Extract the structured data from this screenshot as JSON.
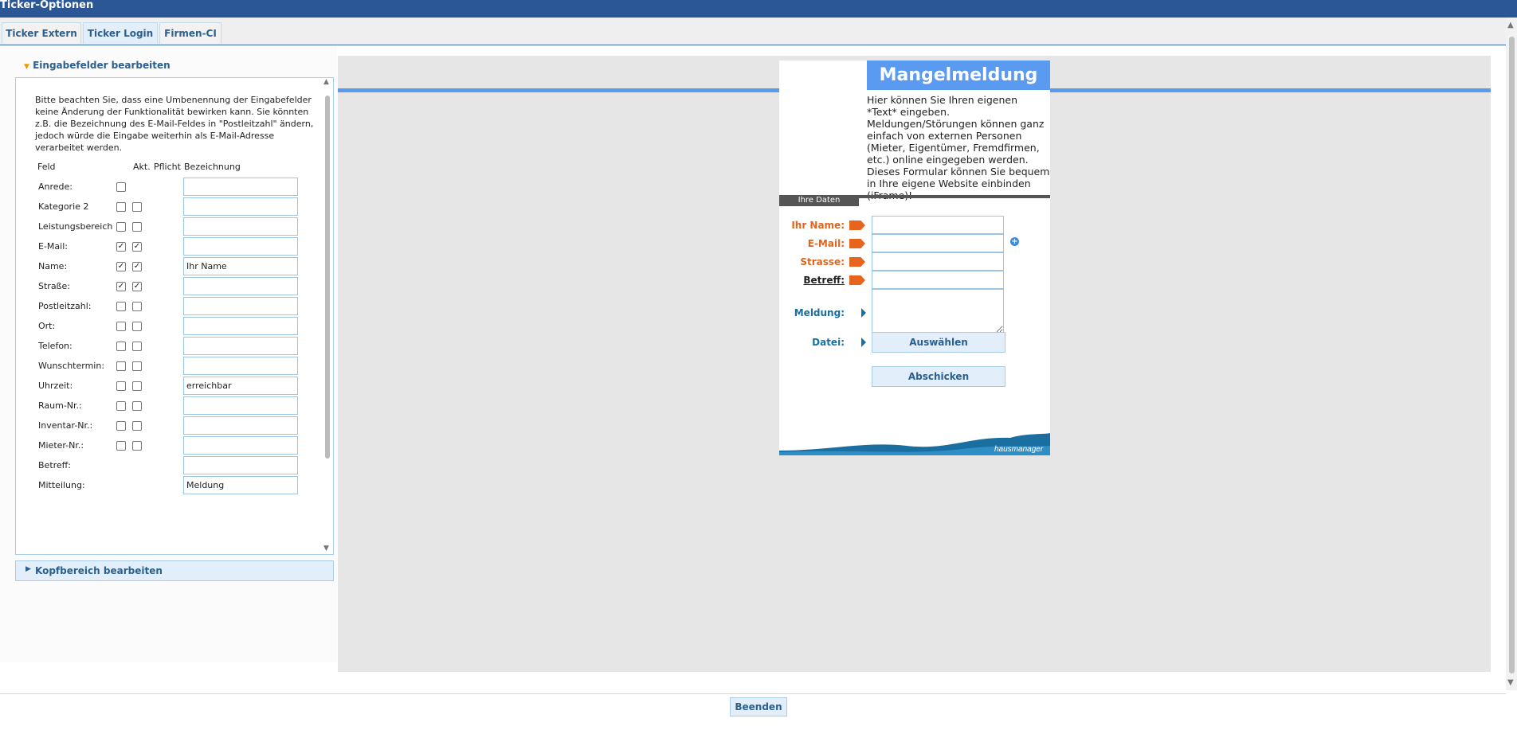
{
  "window": {
    "title": "Ticker-Optionen"
  },
  "tabs": [
    {
      "label": "Ticker Extern"
    },
    {
      "label": "Ticker Login"
    },
    {
      "label": "Firmen-CI"
    }
  ],
  "left": {
    "section1": {
      "title": "Eingabefelder bearbeiten",
      "info": "Bitte beachten Sie, dass eine Umbenennung der Eingabefelder keine Änderung der Funktionalität bewirken kann. Sie könnten z.B. die Bezeichnung des E-Mail-Feldes in \"Postleitzahl\" ändern, jedoch würde die Eingabe weiterhin als E-Mail-Adresse verarbeitet werden.",
      "col_field": "Feld",
      "col_active": "Akt.",
      "col_required": "Pflicht",
      "col_label": "Bezeichnung",
      "rows": [
        {
          "field": "Anrede:",
          "active": false,
          "required": null,
          "value": ""
        },
        {
          "field": "Kategorie 2",
          "active": false,
          "required": false,
          "value": ""
        },
        {
          "field": "Leistungsbereich",
          "active": false,
          "required": false,
          "value": ""
        },
        {
          "field": "E-Mail:",
          "active": true,
          "required": true,
          "value": ""
        },
        {
          "field": "Name:",
          "active": true,
          "required": true,
          "value": "Ihr Name"
        },
        {
          "field": "Straße:",
          "active": true,
          "required": true,
          "value": ""
        },
        {
          "field": "Postleitzahl:",
          "active": false,
          "required": false,
          "value": ""
        },
        {
          "field": "Ort:",
          "active": false,
          "required": false,
          "value": ""
        },
        {
          "field": "Telefon:",
          "active": false,
          "required": false,
          "value": ""
        },
        {
          "field": "Wunschtermin:",
          "active": false,
          "required": false,
          "value": ""
        },
        {
          "field": "Uhrzeit:",
          "active": false,
          "required": false,
          "value": "erreichbar"
        },
        {
          "field": "Raum-Nr.:",
          "active": false,
          "required": false,
          "value": ""
        },
        {
          "field": "Inventar-Nr.:",
          "active": false,
          "required": false,
          "value": ""
        },
        {
          "field": "Mieter-Nr.:",
          "active": false,
          "required": false,
          "value": ""
        },
        {
          "field": "Betreff:",
          "active": null,
          "required": null,
          "value": ""
        },
        {
          "field": "Mitteilung:",
          "active": null,
          "required": null,
          "value": "Meldung"
        }
      ]
    },
    "section2": {
      "title": "Kopfbereich bearbeiten"
    }
  },
  "preview": {
    "title": "Mangelmeldung",
    "text": "Hier können Sie Ihren eigenen *Text* eingeben. Meldungen/Störungen können ganz einfach von externen Personen (Mieter, Eigentümer, Fremdfirmen, etc.) online eingegeben werden. Dieses Formular können Sie bequem in Ihre eigene Website einbinden (iFrame)!",
    "section_label": "Ihre Daten",
    "fields": {
      "name": "Ihr Name:",
      "email": "E-Mail:",
      "strasse": "Strasse:",
      "betreff": "Betreff:",
      "meldung": "Meldung:",
      "datei": "Datei:"
    },
    "choose_button": "Auswählen",
    "submit_button": "Abschicken",
    "logo_text": "hausmanager",
    "colors": {
      "accent": "#5a9af0",
      "required": "#e8641c",
      "optional": "#1a6fa0",
      "wave": "#1a6fa0"
    }
  },
  "footer": {
    "close_button": "Beenden"
  }
}
